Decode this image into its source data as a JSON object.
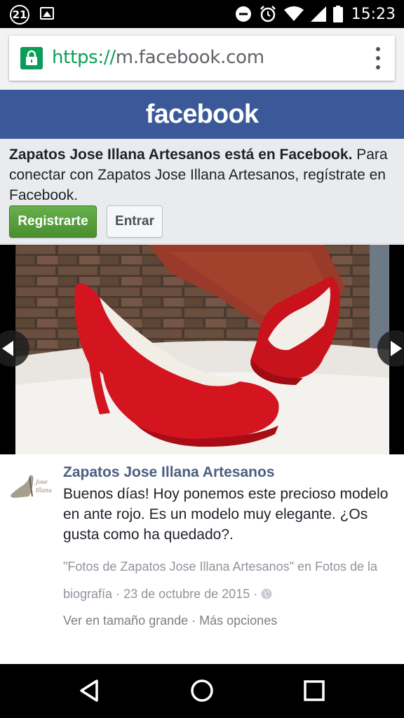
{
  "status_bar": {
    "notification_count": "21",
    "time": "15:23",
    "icons": [
      "notification-count-icon",
      "gallery-icon",
      "do-not-disturb-icon",
      "alarm-icon",
      "wifi-icon",
      "cell-signal-icon",
      "battery-icon"
    ]
  },
  "browser": {
    "url_scheme": "https://",
    "url_host": "m.facebook.com",
    "lock_color": "#0b9d58"
  },
  "header": {
    "logo": "facebook",
    "brand_color": "#3b5998"
  },
  "banner": {
    "page_name_bold": "Zapatos Jose Illana Artesanos está en Facebook.",
    "message": " Para conectar con Zapatos Jose Illana Artesanos, regístrate en Facebook.",
    "register_label": "Registrarte",
    "login_label": "Entrar"
  },
  "post": {
    "author": "Zapatos Jose Illana Artesanos",
    "text": "Buenos días! Hoy ponemos este precioso modelo en ante rojo. Es un modelo muy elegante. ¿Os gusta como ha quedado?.",
    "album_link": "\"Fotos de Zapatos Jose Illana Artesanos\"",
    "in_word": " en ",
    "timeline_link": "Fotos de la biografía",
    "date_sep": " · ",
    "date": "23 de octubre de 2015",
    "date_sep2": " · ",
    "view_full": "Ver en tamaño grande",
    "links_sep": " · ",
    "more_options": "Más opciones"
  },
  "nav_bar": {
    "icons": [
      "back-icon",
      "home-icon",
      "recents-icon"
    ]
  }
}
